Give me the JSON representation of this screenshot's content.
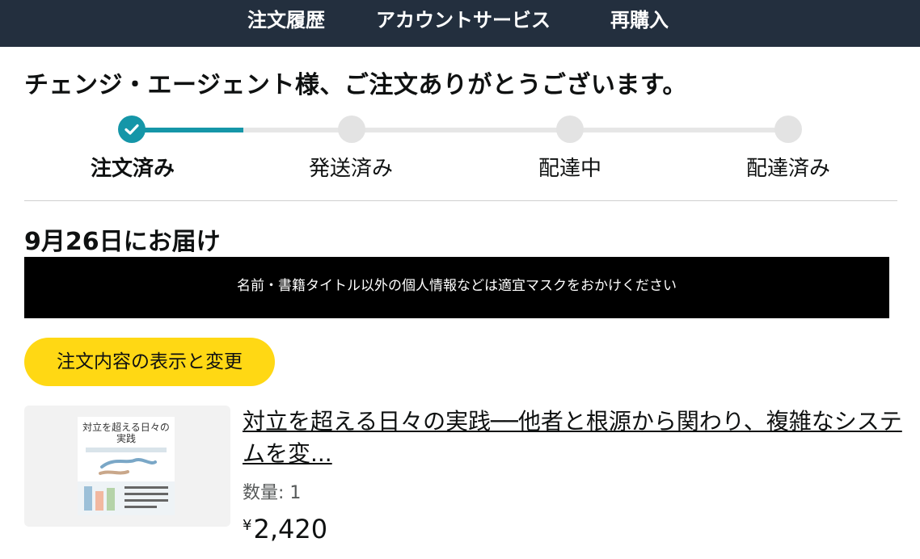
{
  "nav": {
    "items": [
      "注文履歴",
      "アカウントサービス",
      "再購入"
    ]
  },
  "greeting": "チェンジ・エージェント様、ご注文ありがとうございます。",
  "tracker": {
    "progress_fraction": 0.17,
    "steps": [
      {
        "label": "注文済み",
        "state": "done"
      },
      {
        "label": "発送済み",
        "state": "pending"
      },
      {
        "label": "配達中",
        "state": "pending"
      },
      {
        "label": "配達済み",
        "state": "pending"
      }
    ]
  },
  "delivery_heading": "9月26日にお届け",
  "mask_notice": "名前・書籍タイトル以外の個人情報などは適宜マスクをおかけください",
  "order_details_button": "注文内容の表示と変更",
  "item": {
    "cover_title": "対立を超える日々の実践",
    "title": "対立を超える日々の実践──他者と根源から関わり、複雑なシステムを変...",
    "quantity": "数量: 1",
    "currency": "¥",
    "price": "2,420"
  },
  "colors": {
    "nav_bg": "#232f3e",
    "accent": "#1596a8",
    "button_yellow": "#ffd814",
    "inactive_dot": "#e3e3e3"
  }
}
